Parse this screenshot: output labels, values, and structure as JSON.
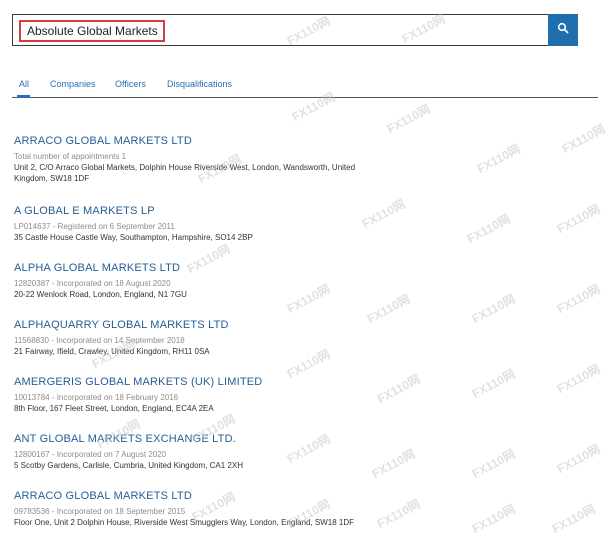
{
  "search": {
    "value": "Absolute Global Markets"
  },
  "tabs": [
    {
      "label": "All",
      "active": true
    },
    {
      "label": "Companies",
      "active": false
    },
    {
      "label": "Officers",
      "active": false
    },
    {
      "label": "Disqualifications",
      "active": false
    }
  ],
  "results": [
    {
      "title": "ARRACO GLOBAL MARKETS LTD",
      "meta": "Total number of appointments 1",
      "address": "Unit 2, C/O Arraco Global Markets, Dolphin House Riverside West, London, Wandsworth, United Kingdom, SW18 1DF"
    },
    {
      "title": "A GLOBAL E MARKETS LP",
      "meta": "LP014637 - Registered on 6 September 2011",
      "address": "35 Castle House Castle Way, Southampton, Hampshire, SO14 2BP"
    },
    {
      "title": "ALPHA GLOBAL MARKETS LTD",
      "meta": "12820387 - Incorporated on 18 August 2020",
      "address": "20-22 Wenlock Road, London, England, N1 7GU"
    },
    {
      "title": "ALPHAQUARRY GLOBAL MARKETS LTD",
      "meta": "11568830 - Incorporated on 14 September 2018",
      "address": "21 Fairway, Ifield, Crawley, United Kingdom, RH11 0SA"
    },
    {
      "title": "AMERGERIS GLOBAL MARKETS (UK) LIMITED",
      "meta": "10013784 - Incorporated on 18 February 2016",
      "address": "8th Floor, 167 Fleet Street, London, England, EC4A 2EA"
    },
    {
      "title": "ANT GLOBAL MARKETS EXCHANGE LTD.",
      "meta": "12800167 - Incorporated on 7 August 2020",
      "address": "5 Scotby Gardens, Carlisle, Cumbria, United Kingdom, CA1 2XH"
    },
    {
      "title": "ARRACO GLOBAL MARKETS LTD",
      "meta": "09783536 - Incorporated on 18 September 2015",
      "address": "Floor One, Unit 2 Dolphin House, Riverside West Smugglers Way, London, England, SW18 1DF"
    }
  ],
  "colors": {
    "link": "#245e96",
    "tab": "#2b6cb0",
    "search_button": "#1f6fae",
    "highlight_border": "#d93a3a"
  },
  "icons": {
    "search_button": "search-icon"
  },
  "watermark": "FX110网"
}
